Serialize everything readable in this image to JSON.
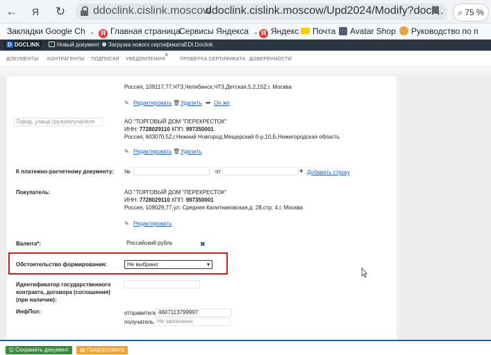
{
  "browser": {
    "domain": "ddoclink.cislink.moscow",
    "url": "ddoclink.cislink.moscow/Upd2024/Modify?doci...",
    "zoom": "75 %",
    "bookmarks": [
      {
        "label": "Закладки Google Ch"
      },
      {
        "label": "Главная страница"
      },
      {
        "label": "Сервисы Яндекса"
      },
      {
        "label": "Яндекс"
      },
      {
        "label": "Почта"
      },
      {
        "label": "Avatar Shop"
      },
      {
        "label": "Руководство по п"
      }
    ]
  },
  "app": {
    "logo": "DOCLINK",
    "links": [
      "Новый документ",
      "Загрузка нового сертификата",
      "EDI.Doclink"
    ]
  },
  "menu": {
    "items": [
      "ДОКУМЕНТЫ",
      "КОНТРАГЕНТЫ",
      "ПОДПИСКИ",
      "УВЕДОМЛЕНИЯ",
      "ПРОВЕРКА СЕРТИФИКАТА",
      "ДОВЕРЕННОСТИ"
    ],
    "notifications_count": "9"
  },
  "shipper": {
    "address": "Россия, 109117,77,ЧТЗ,Челябинск,ЧТЗ,Детская,5,2,152,г. Москва",
    "edit": "Редактировать",
    "delete": "Удалить",
    "same": "Он же"
  },
  "consignee": {
    "city_placeholder": "Город, улица грузополучателя",
    "name": "АО \"ТОРГОВЫЙ ДОМ \"ПЕРЕКРЕСТОК\"",
    "inn_label": "ИНН:",
    "inn": "7728029110",
    "kpp_label": "КПП:",
    "kpp": "997350001",
    "address": "Россия, 603070,52,г.Нижний Новгород,Мещерский б-р,10,Б,Нижегородская область",
    "edit": "Редактировать",
    "delete": "Удалить"
  },
  "payment_doc": {
    "label": "К платежно-расчетному документу:",
    "number_prefix": "№",
    "from_label": "от",
    "add_row": "Добавить строку"
  },
  "buyer": {
    "label": "Покупатель:",
    "name": "АО \"ТОРГОВЫЙ ДОМ \"ПЕРЕКРЕСТОК\"",
    "inn_label": "ИНН:",
    "inn": "7728029110",
    "kpp_label": "КПП:",
    "kpp": "997350001",
    "address": "Россия, 109029,77,ул. Средняя Калитниковская,д. 28,стр. 4,г. Москва",
    "edit": "Редактировать"
  },
  "currency": {
    "label": "Валюта*:",
    "value": "Российский рубль"
  },
  "formation": {
    "label": "Обстоятельство формирования:",
    "selected": "Не выбрано"
  },
  "gov_contract": {
    "label_lines": [
      "Идентификатор государственного",
      "контракта, договора (соглашения)",
      "(при наличии):"
    ]
  },
  "infpol": {
    "label": "ИнфПол:",
    "sender_label": "отправитель:",
    "sender_value": "4607113799997",
    "receiver_label": "получатель:",
    "receiver_placeholder": "Не заполнено"
  },
  "actions": {
    "save": "Сохранить документ",
    "preview": "Предпросмотр"
  }
}
